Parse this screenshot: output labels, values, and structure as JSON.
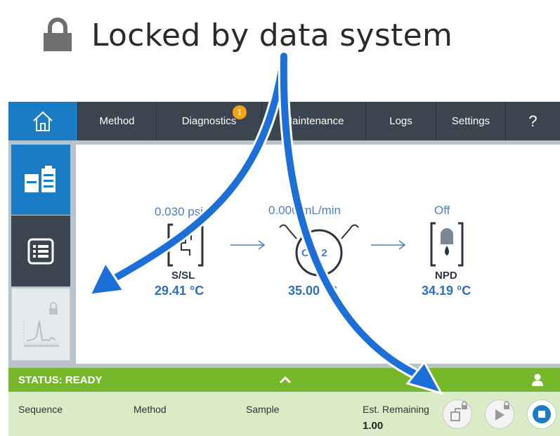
{
  "caption": {
    "text": "Locked by data system",
    "icon": "lock-icon"
  },
  "nav": {
    "home_icon": "home-icon",
    "tabs": [
      "Method",
      "Diagnostics",
      "Maintenance",
      "Logs",
      "Settings",
      "?"
    ],
    "diagnostics_badge": "1"
  },
  "sidebar": {
    "items": [
      {
        "icon": "instrument-status-icon",
        "state": "selected"
      },
      {
        "icon": "list-icon",
        "state": "normal"
      },
      {
        "icon": "chromatogram-icon",
        "state": "locked"
      }
    ]
  },
  "flow": {
    "inlet": {
      "setpoint": "0.030 psi",
      "name": "S/SL",
      "temp": "29.41 °C"
    },
    "column": {
      "setpoint": "0.000 mL/min",
      "name": "Col 2",
      "temp": "35.00 °C"
    },
    "detector": {
      "setpoint": "Off",
      "name": "NPD",
      "temp": "34.19 °C"
    }
  },
  "status": {
    "label": "STATUS: READY",
    "user_icon": "user-icon"
  },
  "info": {
    "sequence_label": "Sequence",
    "method_label": "Method",
    "sample_label": "Sample",
    "est_remaining_label": "Est. Remaining",
    "est_remaining_value": "1.00"
  },
  "colors": {
    "accent_blue": "#1a7cc4",
    "nav_dark": "#3b4550",
    "status_green": "#76b82a",
    "info_green": "#d9ebc7",
    "arrow_blue": "#1c6fd6",
    "badge_orange": "#f2a31b"
  }
}
